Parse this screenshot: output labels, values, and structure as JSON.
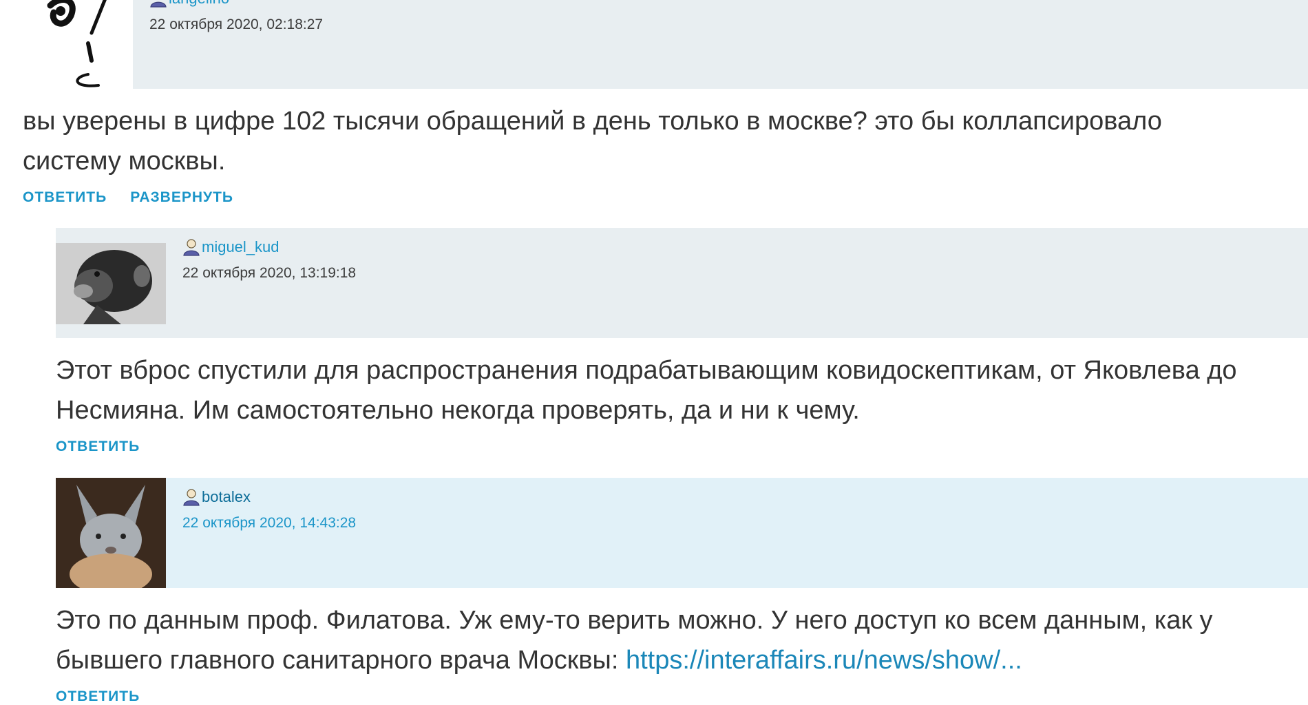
{
  "comments": [
    {
      "author": "langelino",
      "date": "22 октября 2020, 02:18:27",
      "text": "вы уверены в цифре 102 тысячи обращений в день только в москве? это бы коллапсировало систему москвы.",
      "actions": [
        "ОТВЕТИТЬ",
        "РАЗВЕРНУТЬ"
      ]
    },
    {
      "author": "miguel_kud",
      "date": "22 октября 2020, 13:19:18",
      "text": "Этот вброс спустили для распространения подрабатывающим ковидоскептикам, от Яковлева до Несмияна. Им самостоятельно некогда проверять, да и ни к чему.",
      "actions": [
        "ОТВЕТИТЬ"
      ]
    },
    {
      "author": "botalex",
      "date": "22 октября 2020, 14:43:28",
      "text": "Это по данным проф. Филатова. Уж ему-то верить можно. У него доступ ко всем данным, как у бывшего главного санитарного врача Москвы:",
      "link": "https://interaffairs.ru/news/show/...",
      "actions": [
        "ОТВЕТИТЬ"
      ]
    }
  ],
  "colors": {
    "accent": "#1b95c8",
    "header_bg": "#e8eef1",
    "header_highlight_bg": "#e1f1f8",
    "text": "#333333"
  },
  "icons": {
    "user": "user-icon",
    "avatar_1": "sketch-avatar",
    "avatar_2": "chimpanzee-avatar",
    "avatar_3": "hare-avatar"
  }
}
